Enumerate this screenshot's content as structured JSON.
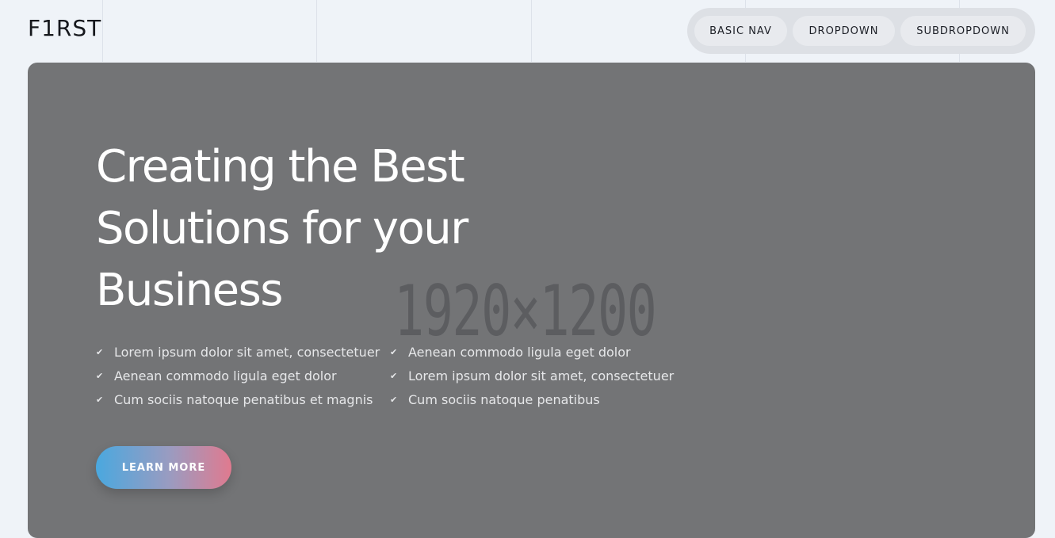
{
  "header": {
    "logo": "F1RST",
    "nav": [
      {
        "label": "BASIC NAV"
      },
      {
        "label": "DROPDOWN"
      },
      {
        "label": "SUBDROPDOWN"
      }
    ]
  },
  "hero": {
    "placeholder_text": "1920×1200",
    "title": "Creating the Best Solutions for your Business",
    "features_left": [
      "Lorem ipsum dolor sit amet, consectetuer",
      "Aenean commodo ligula eget dolor",
      "Cum sociis natoque penatibus et magnis"
    ],
    "features_right": [
      "Aenean commodo ligula eget dolor",
      "Lorem ipsum dolor sit amet, consectetuer",
      "Cum sociis natoque penatibus"
    ],
    "check_icon": "check-icon",
    "cta_label": "LEARN MORE"
  },
  "colors": {
    "page_bg": "#eff3f8",
    "hero_bg": "#737476",
    "cta_gradient_start": "#4aa8df",
    "cta_gradient_end": "#e07a8f"
  }
}
